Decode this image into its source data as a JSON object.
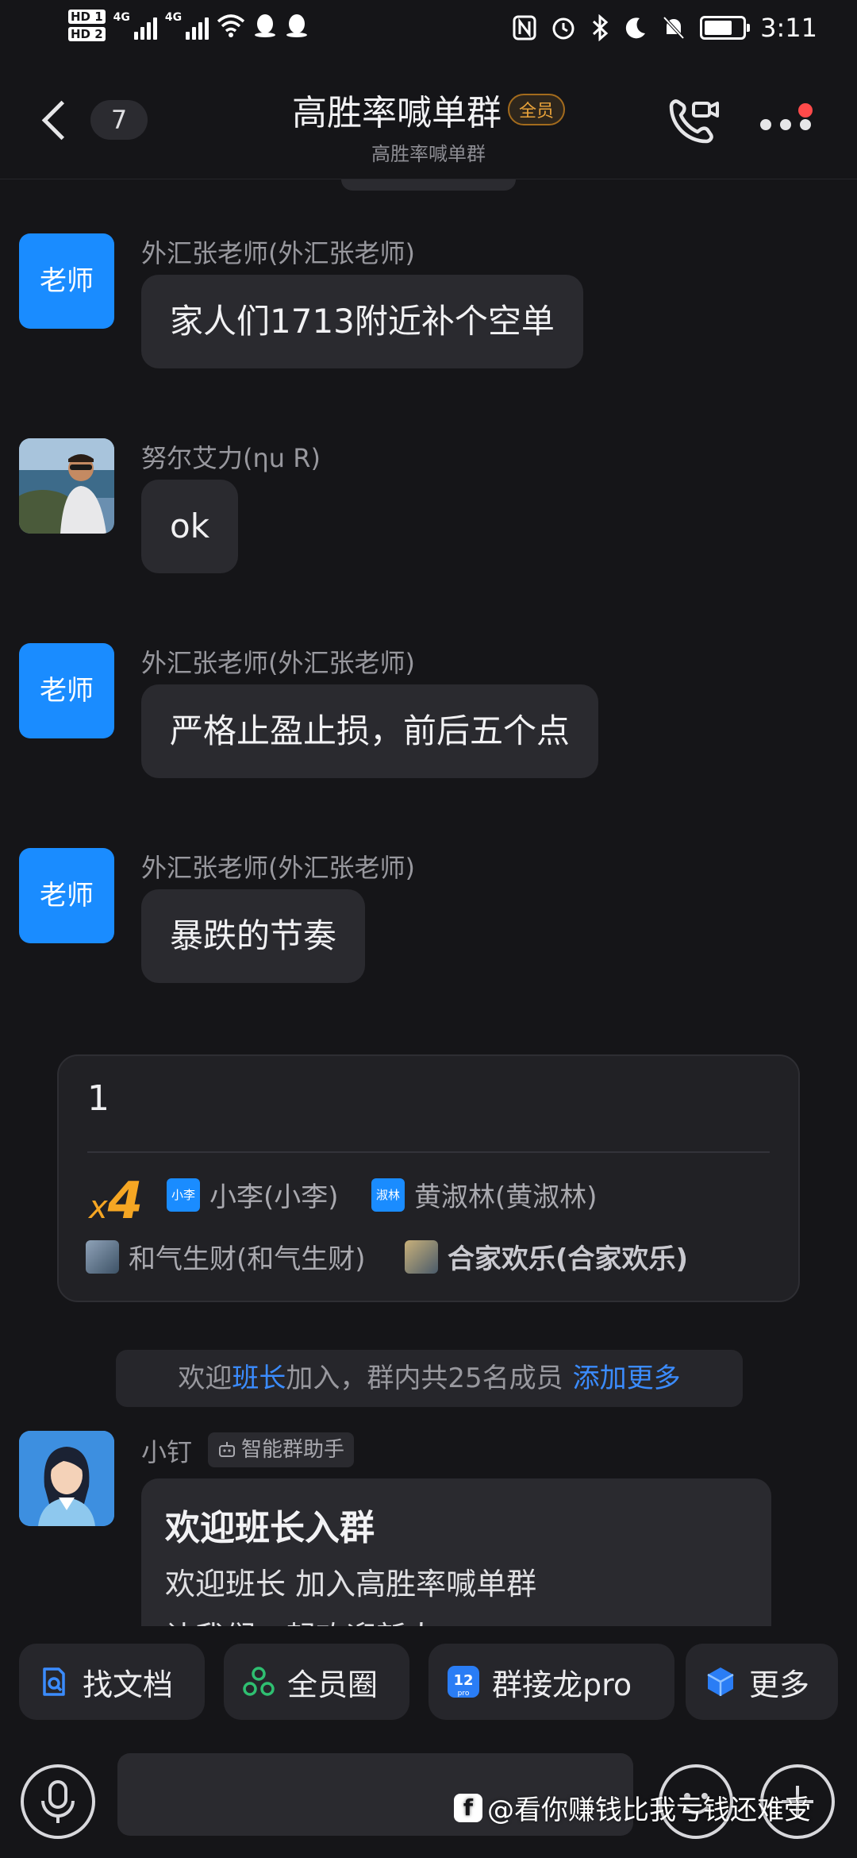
{
  "status_bar": {
    "hd1": "HD 1",
    "hd2": "HD 2",
    "net1": "4G",
    "net2": "4G",
    "time": "3:11"
  },
  "header": {
    "unread_count": "7",
    "title": "高胜率喊单群",
    "member_tag": "全员",
    "subtitle": "高胜率喊单群"
  },
  "messages": [
    {
      "sender": "外汇张老师(外汇张老师)",
      "avatar_text": "老师",
      "text": "家人们1713附近补个空单"
    },
    {
      "sender": "努尔艾力(ηu R)",
      "avatar_text": "",
      "text": "ok"
    },
    {
      "sender": "外汇张老师(外汇张老师)",
      "avatar_text": "老师",
      "text": "严格止盈止损，前后五个点"
    },
    {
      "sender": "外汇张老师(外汇张老师)",
      "avatar_text": "老师",
      "text": "暴跌的节奏"
    }
  ],
  "solitaire": {
    "title": "1",
    "count_prefix": "x",
    "count": "4",
    "participants": [
      {
        "badge": "小李",
        "name": "小李(小李)"
      },
      {
        "badge": "淑林",
        "name": "黄淑林(黄淑林)"
      },
      {
        "badge": "",
        "name": "和气生财(和气生财)"
      },
      {
        "badge": "",
        "name": "合家欢乐(合家欢乐)"
      }
    ]
  },
  "notice": {
    "prefix": "欢迎",
    "highlight": "班长",
    "suffix": "加入，群内共25名成员",
    "link": "添加更多"
  },
  "bot": {
    "name": "小钉",
    "tag": "智能群助手",
    "card_title": "欢迎班长入群",
    "line1": "欢迎班长 加入高胜率喊单群",
    "line2": "让我们一起欢迎新人~"
  },
  "chips": [
    {
      "label": "找文档",
      "icon": "doc-search-icon"
    },
    {
      "label": "全员圈",
      "icon": "circle-icon"
    },
    {
      "label": "群接龙pro",
      "icon": "solitaire-icon"
    },
    {
      "label": "更多",
      "icon": "cube-icon"
    }
  ],
  "input": {
    "placeholder": ""
  },
  "watermark": "@看你赚钱比我亏钱还难受",
  "colors": {
    "accent": "#1a8cff",
    "link": "#3b8cff",
    "gold": "#f5a623",
    "background": "#151518",
    "bubble": "#2a2a2f"
  }
}
